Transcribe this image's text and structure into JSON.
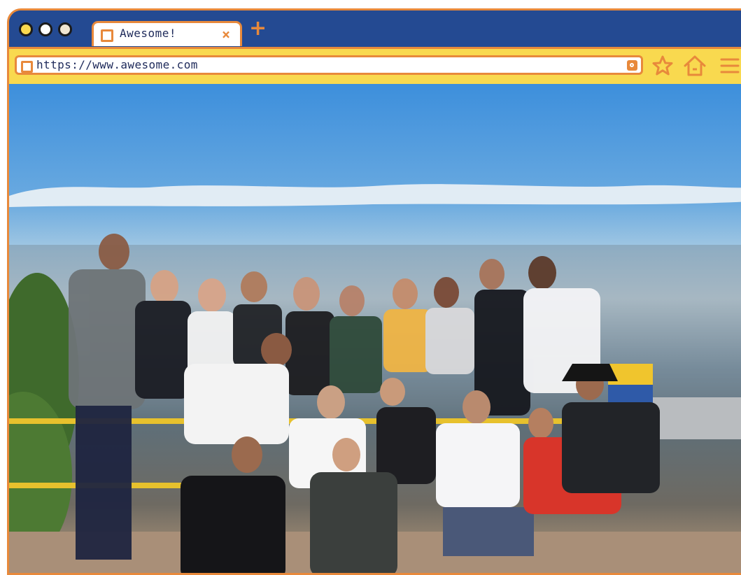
{
  "browser": {
    "window_controls": [
      "close-dot",
      "minimize-dot",
      "maximize-dot"
    ],
    "tab": {
      "title": "Awesome!",
      "close_icon": "×"
    },
    "new_tab_icon": "+",
    "address_bar": {
      "url": "https://www.awesome.com"
    },
    "toolbar_icons": [
      "star-icon",
      "home-icon",
      "menu-icon"
    ]
  },
  "content": {
    "photo_subject": "group-photo"
  },
  "colors": {
    "frame_orange": "#e8893b",
    "titlebar_blue": "#244a92",
    "toolbar_yellow": "#f9d94f"
  }
}
